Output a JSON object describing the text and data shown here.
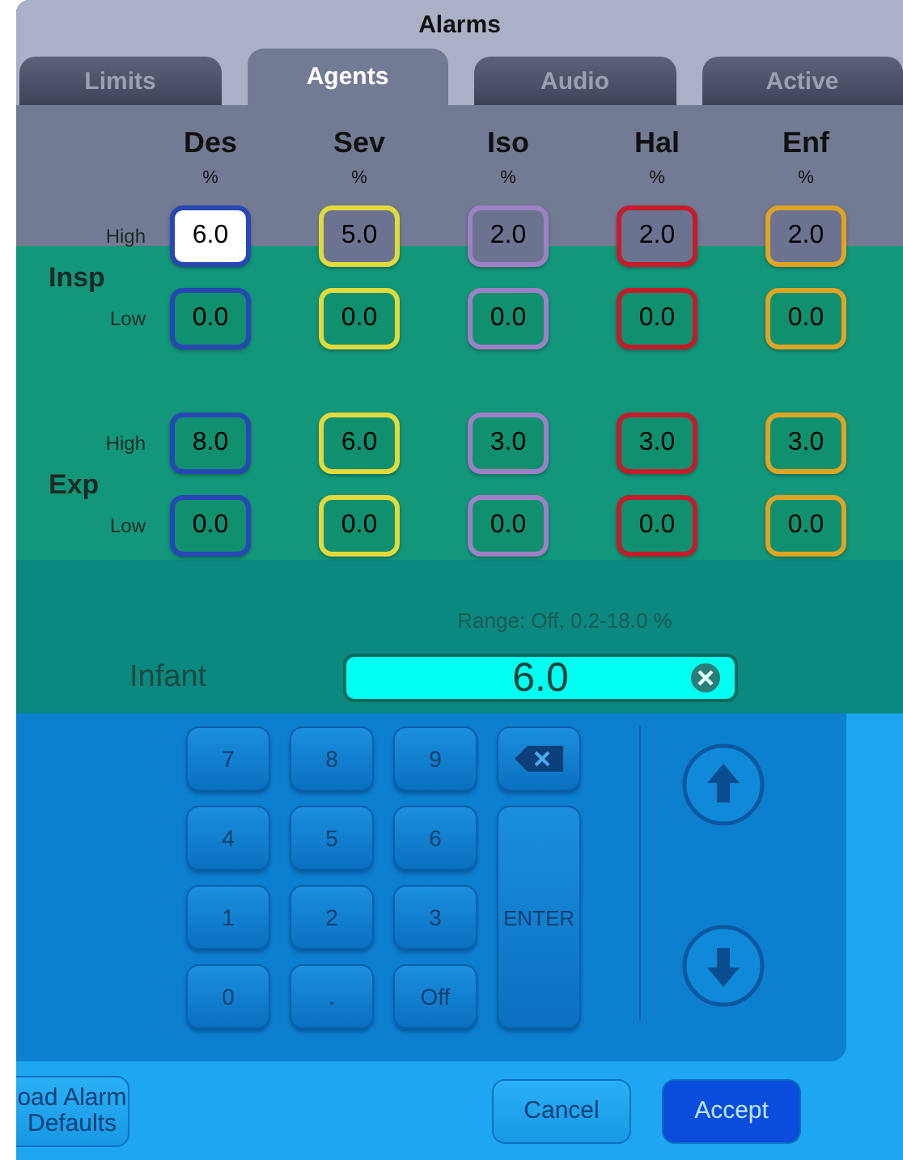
{
  "window": {
    "title": "Alarms"
  },
  "tabs": [
    {
      "label": "Limits",
      "selected": false
    },
    {
      "label": "Agents",
      "selected": true
    },
    {
      "label": "Audio",
      "selected": false
    },
    {
      "label": "Active",
      "selected": false
    }
  ],
  "agents": [
    {
      "name": "Des",
      "unit": "%",
      "color": "#2846b4"
    },
    {
      "name": "Sev",
      "unit": "%",
      "color": "#e2da3c"
    },
    {
      "name": "Iso",
      "unit": "%",
      "color": "#9e80c6"
    },
    {
      "name": "Hal",
      "unit": "%",
      "color": "#c41c2a"
    },
    {
      "name": "Enf",
      "unit": "%",
      "color": "#e0a424"
    }
  ],
  "groups": [
    {
      "label": "Insp",
      "rows": [
        {
          "label": "High",
          "cells": [
            {
              "value": "6.0",
              "selected": true
            },
            {
              "value": "5.0",
              "selected": false
            },
            {
              "value": "2.0",
              "selected": false
            },
            {
              "value": "2.0",
              "selected": false
            },
            {
              "value": "2.0",
              "selected": false
            }
          ]
        },
        {
          "label": "Low",
          "cells": [
            {
              "value": "0.0",
              "selected": false
            },
            {
              "value": "0.0",
              "selected": false
            },
            {
              "value": "0.0",
              "selected": false
            },
            {
              "value": "0.0",
              "selected": false
            },
            {
              "value": "0.0",
              "selected": false
            }
          ]
        }
      ]
    },
    {
      "label": "Exp",
      "rows": [
        {
          "label": "High",
          "cells": [
            {
              "value": "8.0",
              "selected": false
            },
            {
              "value": "6.0",
              "selected": false
            },
            {
              "value": "3.0",
              "selected": false
            },
            {
              "value": "3.0",
              "selected": false
            },
            {
              "value": "3.0",
              "selected": false
            }
          ]
        },
        {
          "label": "Low",
          "cells": [
            {
              "value": "0.0",
              "selected": false
            },
            {
              "value": "0.0",
              "selected": false
            },
            {
              "value": "0.0",
              "selected": false
            },
            {
              "value": "0.0",
              "selected": false
            },
            {
              "value": "0.0",
              "selected": false
            }
          ]
        }
      ]
    }
  ],
  "entry": {
    "range": "Range: Off, 0.2-18.0 %",
    "label": "Infant",
    "value": "6.0"
  },
  "keypad": [
    {
      "kind": "digit",
      "label": "7"
    },
    {
      "kind": "digit",
      "label": "8"
    },
    {
      "kind": "digit",
      "label": "9"
    },
    {
      "kind": "backspace"
    },
    {
      "kind": "digit",
      "label": "4"
    },
    {
      "kind": "digit",
      "label": "5"
    },
    {
      "kind": "digit",
      "label": "6"
    },
    {
      "kind": "digit",
      "label": "1"
    },
    {
      "kind": "digit",
      "label": "2"
    },
    {
      "kind": "digit",
      "label": "3"
    },
    {
      "kind": "enter",
      "label": "ENTER"
    },
    {
      "kind": "digit",
      "label": "0"
    },
    {
      "kind": "digit",
      "label": "."
    },
    {
      "kind": "digit",
      "label": "Off"
    }
  ],
  "footer": {
    "buttons": [
      {
        "kind": "secondary",
        "label": "oad Alarm Defaults"
      },
      {
        "kind": "spacer"
      },
      {
        "kind": "secondary",
        "label": "Cancel"
      },
      {
        "kind": "primary",
        "label": "Accept"
      }
    ]
  }
}
